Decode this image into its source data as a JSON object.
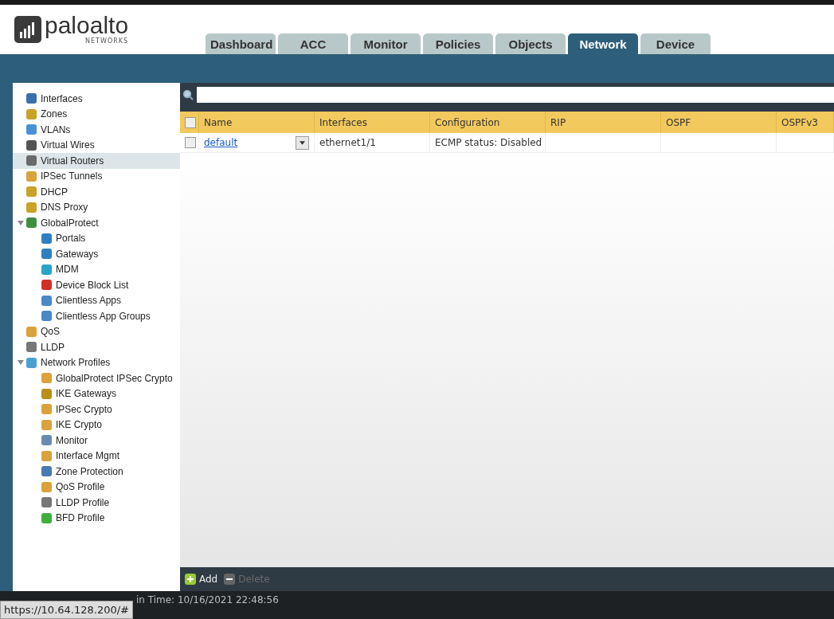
{
  "logo": {
    "name": "paloalto",
    "sub": "NETWORKS"
  },
  "tabs": [
    {
      "label": "Dashboard",
      "selected": false
    },
    {
      "label": "ACC",
      "selected": false
    },
    {
      "label": "Monitor",
      "selected": false
    },
    {
      "label": "Policies",
      "selected": false
    },
    {
      "label": "Objects",
      "selected": false
    },
    {
      "label": "Network",
      "selected": true
    },
    {
      "label": "Device",
      "selected": false
    }
  ],
  "sidebar": {
    "items": [
      {
        "label": "Interfaces",
        "selected": false,
        "color": "#3a6fb0"
      },
      {
        "label": "Zones",
        "selected": false,
        "color": "#c9a227"
      },
      {
        "label": "VLANs",
        "selected": false,
        "color": "#4a90d9"
      },
      {
        "label": "Virtual Wires",
        "selected": false,
        "color": "#555555"
      },
      {
        "label": "Virtual Routers",
        "selected": true,
        "color": "#6a6a6a"
      },
      {
        "label": "IPSec Tunnels",
        "selected": false,
        "color": "#d9a23a"
      },
      {
        "label": "DHCP",
        "selected": false,
        "color": "#c9a227"
      },
      {
        "label": "DNS Proxy",
        "selected": false,
        "color": "#c9a227"
      },
      {
        "label": "GlobalProtect",
        "selected": false,
        "color": "#3f8f3f",
        "expanded": true,
        "children": [
          {
            "label": "Portals",
            "selected": false,
            "color": "#2f7fc0"
          },
          {
            "label": "Gateways",
            "selected": false,
            "color": "#2f7fc0"
          },
          {
            "label": "MDM",
            "selected": false,
            "color": "#2aa3c9"
          },
          {
            "label": "Device Block List",
            "selected": false,
            "color": "#d0302a"
          },
          {
            "label": "Clientless Apps",
            "selected": false,
            "color": "#4a88c8"
          },
          {
            "label": "Clientless App Groups",
            "selected": false,
            "color": "#4a88c8"
          }
        ]
      },
      {
        "label": "QoS",
        "selected": false,
        "color": "#d9a23a"
      },
      {
        "label": "LLDP",
        "selected": false,
        "color": "#777777"
      },
      {
        "label": "Network Profiles",
        "selected": false,
        "color": "#4a9fd0",
        "expanded": true,
        "children": [
          {
            "label": "GlobalProtect IPSec Crypto",
            "selected": false,
            "color": "#d9a23a"
          },
          {
            "label": "IKE Gateways",
            "selected": false,
            "color": "#b8901a"
          },
          {
            "label": "IPSec Crypto",
            "selected": false,
            "color": "#d9a23a"
          },
          {
            "label": "IKE Crypto",
            "selected": false,
            "color": "#d9a23a"
          },
          {
            "label": "Monitor",
            "selected": false,
            "color": "#6a8ab0"
          },
          {
            "label": "Interface Mgmt",
            "selected": false,
            "color": "#d9a23a"
          },
          {
            "label": "Zone Protection",
            "selected": false,
            "color": "#4a78b0"
          },
          {
            "label": "QoS Profile",
            "selected": false,
            "color": "#d9a23a"
          },
          {
            "label": "LLDP Profile",
            "selected": false,
            "color": "#777777"
          },
          {
            "label": "BFD Profile",
            "selected": false,
            "color": "#3fae3f"
          }
        ]
      }
    ]
  },
  "table": {
    "columns": [
      "Name",
      "Interfaces",
      "Configuration",
      "RIP",
      "OSPF",
      "OSPFv3"
    ],
    "header_checked": false,
    "rows": [
      {
        "checked": false,
        "cells": [
          "default",
          "ethernet1/1",
          "ECMP status: Disabled",
          "",
          "",
          ""
        ]
      }
    ]
  },
  "toolbar": [
    {
      "label": "Add",
      "disabled": false
    },
    {
      "label": "Delete",
      "disabled": true
    }
  ],
  "status_bar": {
    "url": "https://10.64.128.200/#",
    "text": "in Time: 10/16/2021 22:48:56"
  }
}
